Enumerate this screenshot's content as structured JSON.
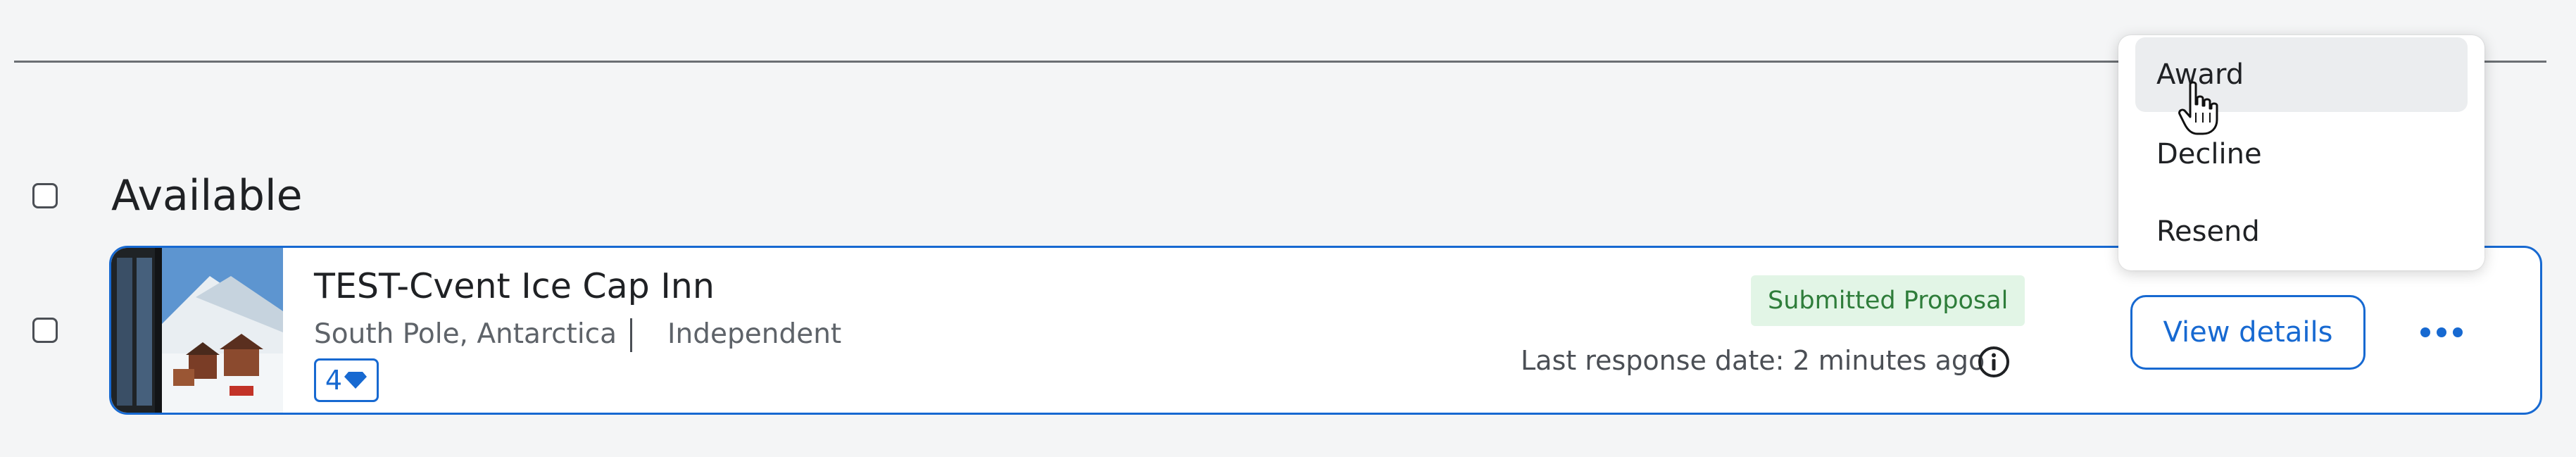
{
  "section": {
    "title": "Available"
  },
  "hotel": {
    "name": "TEST-Cvent Ice Cap Inn",
    "location": "South Pole, Antarctica",
    "type": "Independent",
    "tier": "4",
    "tier_icon": "diamond-icon",
    "status": "Submitted Proposal",
    "last_response": "Last response date: 2 minutes ago",
    "view_details_label": "View details",
    "image_alt": "Hotel photo"
  },
  "menu": {
    "items": [
      {
        "label": "Award",
        "hovered": true
      },
      {
        "label": "Decline",
        "hovered": false
      },
      {
        "label": "Resend",
        "hovered": false
      }
    ]
  },
  "colors": {
    "accent": "#1769d1",
    "status_bg": "#e2f5e6",
    "status_text": "#2e7d3a",
    "page_bg": "#f4f5f6"
  }
}
